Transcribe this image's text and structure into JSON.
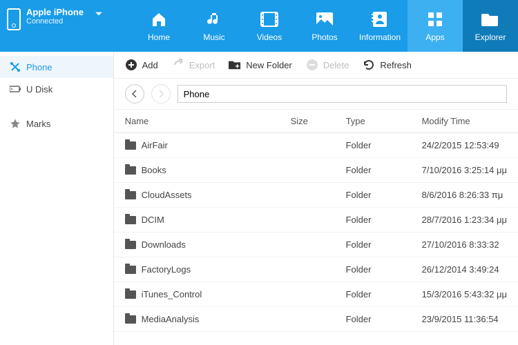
{
  "device": {
    "name": "Apple iPhone",
    "status": "Connected"
  },
  "nav": {
    "home": "Home",
    "music": "Music",
    "videos": "Videos",
    "photos": "Photos",
    "information": "Information",
    "apps": "Apps",
    "explorer": "Explorer"
  },
  "sidebar": {
    "phone": "Phone",
    "udisk": "U Disk",
    "marks": "Marks"
  },
  "toolbar": {
    "add": "Add",
    "export": "Export",
    "newfolder": "New Folder",
    "delete": "Delete",
    "refresh": "Refresh"
  },
  "path": {
    "value": "Phone"
  },
  "table": {
    "headers": {
      "name": "Name",
      "size": "Size",
      "type": "Type",
      "time": "Modify Time"
    },
    "rows": [
      {
        "name": "AirFair",
        "size": "",
        "type": "Folder",
        "time": "24/2/2015 12:53:49 "
      },
      {
        "name": "Books",
        "size": "",
        "type": "Folder",
        "time": "7/10/2016 3:25:14 μμ"
      },
      {
        "name": "CloudAssets",
        "size": "",
        "type": "Folder",
        "time": "8/6/2016 8:26:33 πμ"
      },
      {
        "name": "DCIM",
        "size": "",
        "type": "Folder",
        "time": "28/7/2016 1:23:34 μμ"
      },
      {
        "name": "Downloads",
        "size": "",
        "type": "Folder",
        "time": "27/10/2016 8:33:32 "
      },
      {
        "name": "FactoryLogs",
        "size": "",
        "type": "Folder",
        "time": "26/12/2014 3:49:24 "
      },
      {
        "name": "iTunes_Control",
        "size": "",
        "type": "Folder",
        "time": "15/3/2016 5:43:32 μμ"
      },
      {
        "name": "MediaAnalysis",
        "size": "",
        "type": "Folder",
        "time": "23/9/2015 11:36:54 "
      }
    ]
  }
}
